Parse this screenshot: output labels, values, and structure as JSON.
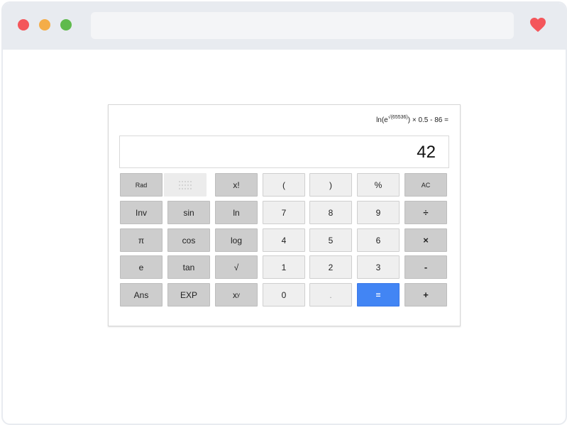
{
  "calculator": {
    "expression": {
      "prefix": "ln(e",
      "exponent": "√(65536)",
      "suffix": ") × 0.5 - 86 ="
    },
    "result": "42",
    "keys": {
      "rad": "Rad",
      "factorial": "x!",
      "open_paren": "(",
      "close_paren": ")",
      "percent": "%",
      "clear": "AC",
      "inv": "Inv",
      "sin": "sin",
      "ln": "ln",
      "k7": "7",
      "k8": "8",
      "k9": "9",
      "divide": "÷",
      "pi": "π",
      "cos": "cos",
      "log": "log",
      "k4": "4",
      "k5": "5",
      "k6": "6",
      "multiply": "×",
      "e": "e",
      "tan": "tan",
      "sqrt": "√",
      "k1": "1",
      "k2": "2",
      "k3": "3",
      "minus": "-",
      "ans": "Ans",
      "exp": "EXP",
      "power_base": "x",
      "power_exp": "y",
      "k0": "0",
      "decimal": ".",
      "equals": "=",
      "plus": "+"
    }
  },
  "colors": {
    "equals_key": "#4285f4",
    "function_key": "#cdcdcd",
    "digit_key": "#efefef",
    "close_dot": "#f4565b",
    "minimize_dot": "#f4ad48",
    "maximize_dot": "#5fba4d",
    "heart": "#f4565b"
  }
}
